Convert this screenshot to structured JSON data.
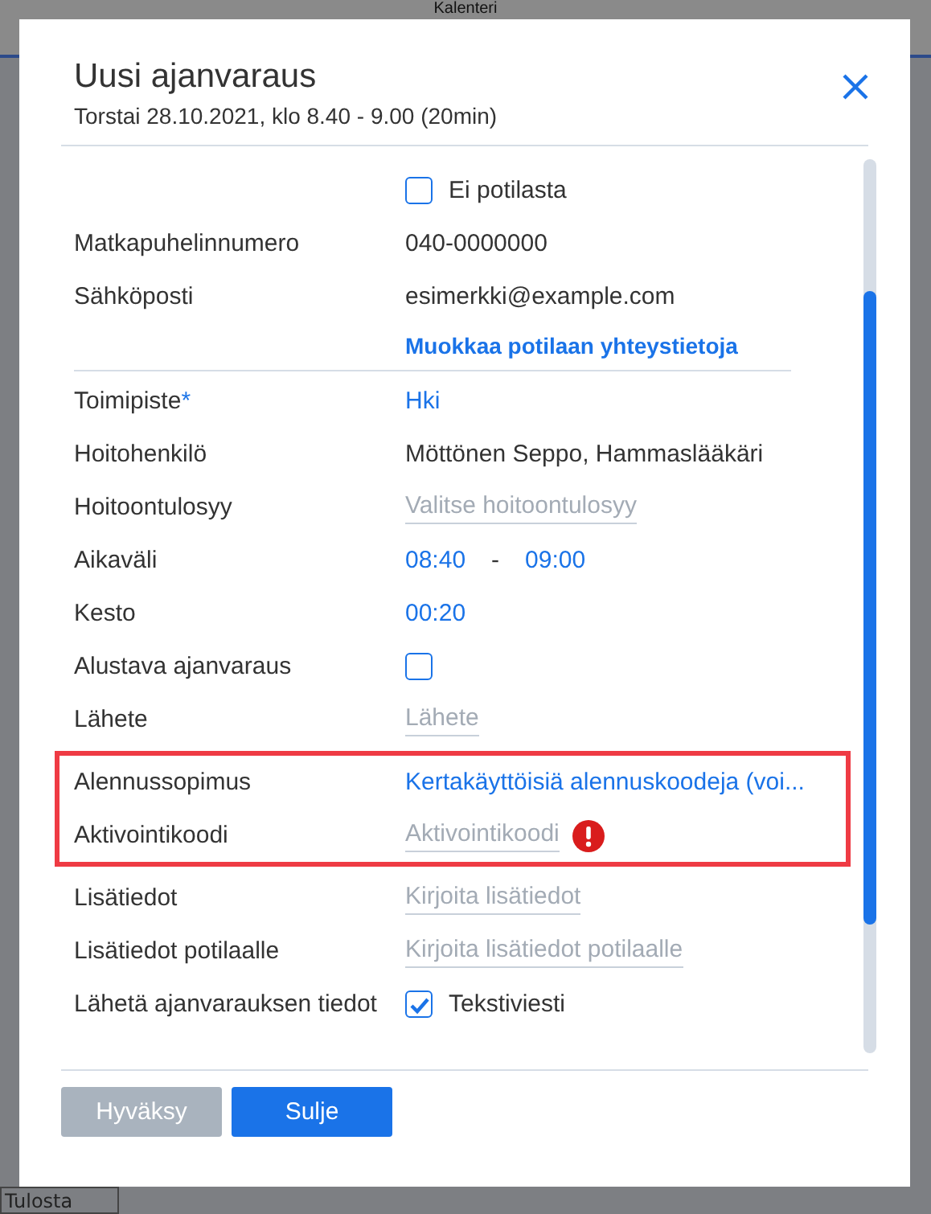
{
  "background": {
    "title": "Kalenteri",
    "print_select": "Tulosta"
  },
  "dialog": {
    "title": "Uusi ajanvaraus",
    "subtitle": "Torstai 28.10.2021, klo 8.40 - 9.00 (20min)",
    "rows": [
      {
        "kind": "checkbox",
        "option": "Ei potilasta",
        "checked": false,
        "highlight": false
      },
      {
        "kind": "text",
        "label": "Matkapuhelinnumero",
        "value": "040-0000000",
        "highlight": false
      },
      {
        "kind": "text",
        "label": "Sähköposti",
        "value": "esimerkki@example.com",
        "highlight": false
      },
      {
        "kind": "link",
        "value": "Muokkaa potilaan yhteystietoja",
        "highlight": false
      },
      {
        "kind": "divider",
        "highlight": false
      },
      {
        "kind": "accent",
        "label": "Toimipiste",
        "required_mark": "*",
        "value": "Hki",
        "highlight": false
      },
      {
        "kind": "text",
        "label": "Hoitohenkilö",
        "value": "Möttönen Seppo, Hammaslääkäri",
        "highlight": false
      },
      {
        "kind": "placeholder",
        "label": "Hoitoontulosyy",
        "placeholder": "Valitse hoitoontulosyy",
        "highlight": false
      },
      {
        "kind": "timerange",
        "label": "Aikaväli",
        "start": "08:40",
        "separator": "-",
        "end": "09:00",
        "highlight": false
      },
      {
        "kind": "accent",
        "label": "Kesto",
        "value": "00:20",
        "highlight": false
      },
      {
        "kind": "checkbox",
        "label": "Alustava ajanvaraus",
        "checked": false,
        "highlight": false
      },
      {
        "kind": "placeholder",
        "label": "Lähete",
        "placeholder": "Lähete",
        "highlight": false
      },
      {
        "kind": "accent",
        "label": "Alennussopimus",
        "value": "Kertakäyttöisiä alennuskoodeja (voi...",
        "highlight": true
      },
      {
        "kind": "placeholder",
        "label": "Aktivointikoodi",
        "placeholder": "Aktivointikoodi",
        "error": true,
        "highlight": true
      },
      {
        "kind": "placeholder",
        "label": "Lisätiedot",
        "placeholder": "Kirjoita lisätiedot",
        "highlight": false
      },
      {
        "kind": "placeholder",
        "label": "Lisätiedot potilaalle",
        "placeholder": "Kirjoita lisätiedot potilaalle",
        "highlight": false
      },
      {
        "kind": "checkbox",
        "label": "Lähetä ajanvarauksen tiedot",
        "option": "Tekstiviesti",
        "checked": true,
        "highlight": false
      }
    ],
    "buttons": [
      {
        "label": "Hyväksy",
        "disabled": true
      },
      {
        "label": "Sulje",
        "disabled": false
      }
    ]
  }
}
